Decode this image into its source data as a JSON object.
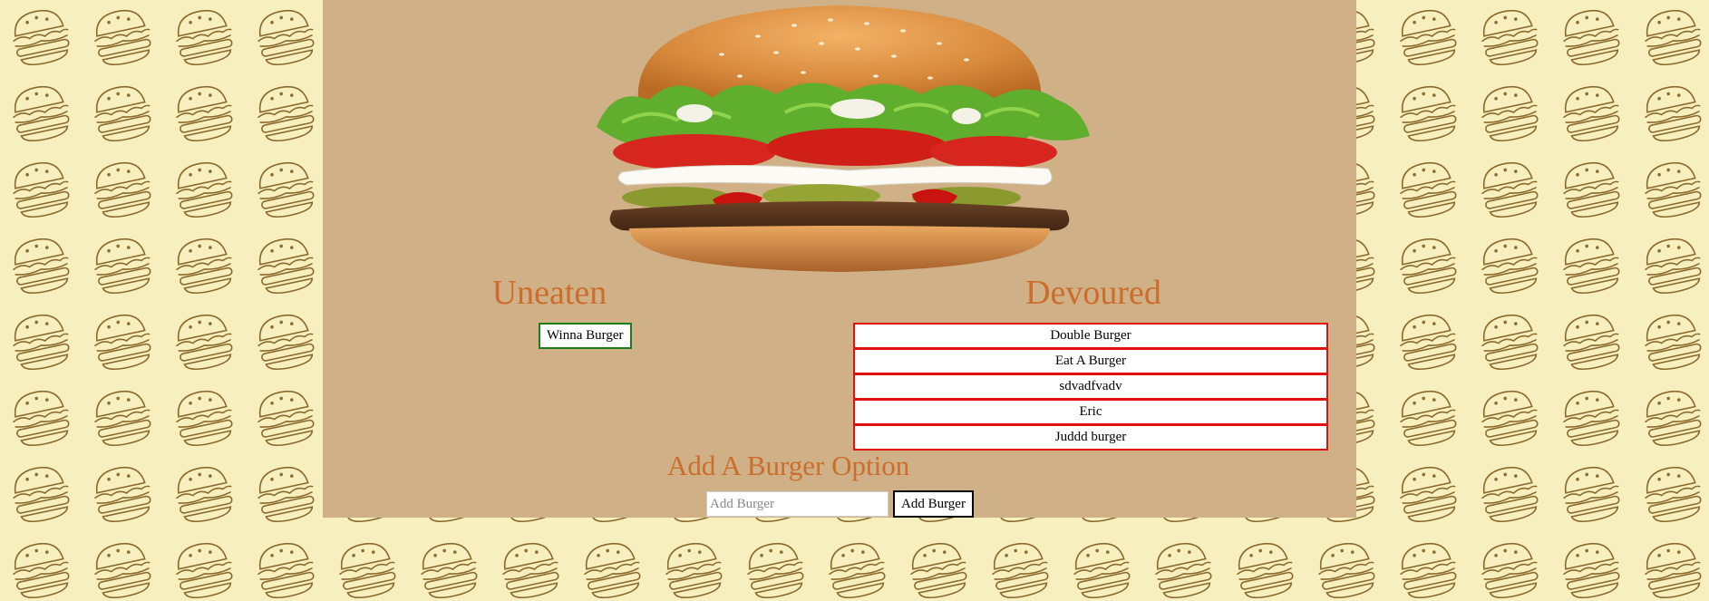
{
  "sections": {
    "uneaten": {
      "title": "Uneaten",
      "items": [
        "Winna Burger"
      ]
    },
    "devoured": {
      "title": "Devoured",
      "items": [
        "Double Burger",
        "Eat A Burger",
        "sdvadfvadv",
        "Eric",
        "Juddd burger"
      ]
    }
  },
  "add_form": {
    "title": "Add A Burger Option",
    "input_placeholder": "Add Burger",
    "input_value": "",
    "button_label": "Add Burger"
  },
  "icons": {
    "hero": "burger-hero-image",
    "background": "burger-outline-pattern"
  },
  "colors": {
    "page_background": "#f8efbe",
    "pattern_stroke": "#8a6a2c",
    "container_background": "#d0b086",
    "heading": "#cc6d2c",
    "uneaten_border": "#1a7f1a",
    "devoured_border": "#e01010"
  }
}
